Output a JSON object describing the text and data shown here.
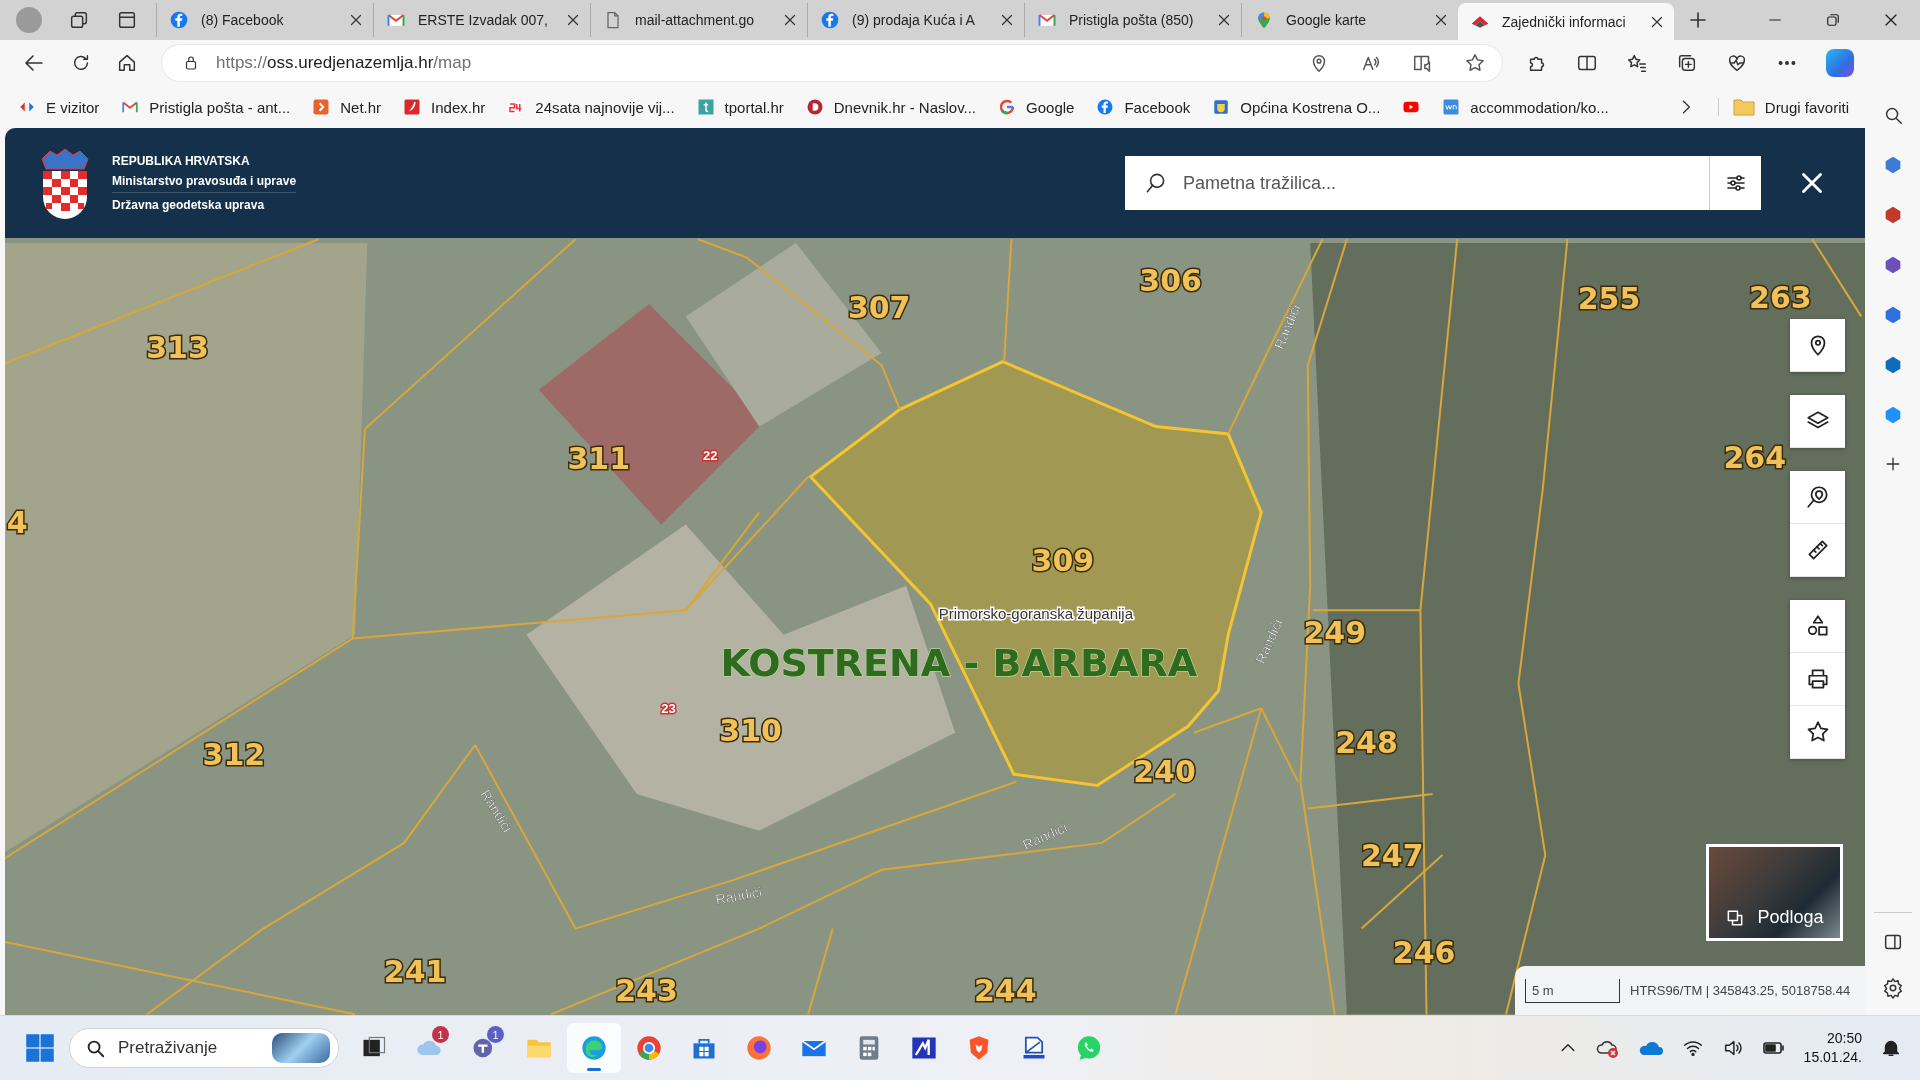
{
  "browser": {
    "tabs": [
      {
        "kind": "facebook",
        "title": "(8) Facebook",
        "selected": false
      },
      {
        "kind": "mail",
        "title": "ERSTE Izvadak 007,",
        "selected": false
      },
      {
        "kind": "document",
        "title": "mail-attachment.go",
        "selected": false
      },
      {
        "kind": "facebook",
        "title": "(9) prodaja Kuća i A",
        "selected": false
      },
      {
        "kind": "mail",
        "title": "Pristigla pošta (850)",
        "selected": false
      },
      {
        "kind": "maps",
        "title": "Google karte",
        "selected": false
      },
      {
        "kind": "site",
        "title": "Zajednički informaci",
        "selected": true
      }
    ],
    "address": {
      "scheme": "https://",
      "host": "oss.uredjenazemlja.hr",
      "path": "/map"
    },
    "bookmarks": [
      {
        "kind": "arrows",
        "label": "E vizitor"
      },
      {
        "kind": "mail",
        "label": "Pristigla pošta - ant..."
      },
      {
        "kind": "chevron",
        "label": "Net.hr"
      },
      {
        "kind": "pepper",
        "label": "Index.hr"
      },
      {
        "kind": "number",
        "label": "24sata najnovije vij..."
      },
      {
        "kind": "tile",
        "label": "tportal.hr"
      },
      {
        "kind": "disc",
        "label": "Dnevnik.hr - Naslov..."
      },
      {
        "kind": "ring",
        "label": "Google"
      },
      {
        "kind": "facebook",
        "label": "Facebook"
      },
      {
        "kind": "crest",
        "label": "Općina Kostrena O..."
      },
      {
        "kind": "video"
      },
      {
        "kind": "square",
        "label": "accommodation/ko..."
      }
    ],
    "other_favorites": "Drugi favoriti"
  },
  "site_header": {
    "title_lines": [
      "REPUBLIKA HRVATSKA",
      "Ministarstvo pravosuđa i uprave",
      "Državna geodetska uprava"
    ],
    "search": {
      "placeholder": "Pametna tražilica..."
    }
  },
  "map": {
    "parcels": [
      {
        "number": "313",
        "selected": false
      },
      {
        "number": "307",
        "selected": false
      },
      {
        "number": "306",
        "selected": false
      },
      {
        "number": "255",
        "selected": false
      },
      {
        "number": "263",
        "selected": false
      },
      {
        "number": "311",
        "selected": false
      },
      {
        "number": "309",
        "selected": true
      },
      {
        "number": "264",
        "selected": false
      },
      {
        "number": "4",
        "selected": false
      },
      {
        "number": "249",
        "selected": false
      },
      {
        "number": "248",
        "selected": false
      },
      {
        "number": "247",
        "selected": false
      },
      {
        "number": "246",
        "selected": false
      },
      {
        "number": "310",
        "selected": false
      },
      {
        "number": "312",
        "selected": false
      },
      {
        "number": "240",
        "selected": false
      },
      {
        "number": "241",
        "selected": false
      },
      {
        "number": "243",
        "selected": false
      },
      {
        "number": "244",
        "selected": false
      }
    ],
    "streets": [
      "Randići",
      "Randići",
      "Randići",
      "Randići",
      "Randići"
    ],
    "region_label": "Primorsko-goranska županija",
    "place_label": "KOSTRENA - BARBARA",
    "house_numbers": [
      "22",
      "23"
    ],
    "basemap_button": "Podloga",
    "scale": "5 m",
    "coordinates": "HTRS96/TM | 345843.25, 5018758.44"
  },
  "taskbar": {
    "search": {
      "placeholder": "Pretraživanje"
    },
    "apps": [
      {
        "kind": "taskview",
        "selected": false
      },
      {
        "kind": "weather",
        "badge": "1",
        "selected": false
      },
      {
        "kind": "chat",
        "badge": "1",
        "selected": false
      },
      {
        "kind": "folder",
        "selected": false
      },
      {
        "kind": "edge",
        "selected": true
      },
      {
        "kind": "chrome",
        "selected": false
      },
      {
        "kind": "store",
        "selected": false
      },
      {
        "kind": "firefox",
        "selected": false
      },
      {
        "kind": "mail",
        "selected": false
      },
      {
        "kind": "calculator",
        "selected": false
      },
      {
        "kind": "app",
        "selected": false
      },
      {
        "kind": "brave",
        "selected": false
      },
      {
        "kind": "scanner",
        "selected": false
      },
      {
        "kind": "whatsapp",
        "selected": false
      }
    ],
    "time": "20:50",
    "date": "15.01.24."
  }
}
